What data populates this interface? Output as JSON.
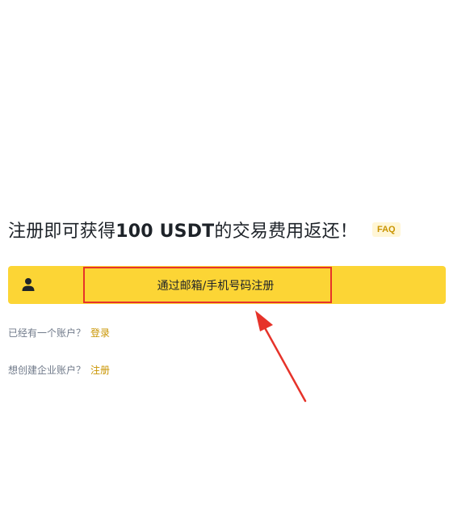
{
  "headline": {
    "prefix": "注册即可获得",
    "amount": "100 USDT",
    "suffix": "的交易费用返还！",
    "faq_label": "FAQ"
  },
  "signup": {
    "button_label": "通过邮箱/手机号码注册",
    "icon": "user-icon"
  },
  "links": {
    "login_prompt": "已经有一个账户？",
    "login_link": "登录",
    "business_prompt": "想创建企业账户？",
    "business_link": "注册"
  },
  "colors": {
    "accent": "#fcd535",
    "link": "#c99400",
    "annotation": "#e6332a"
  }
}
